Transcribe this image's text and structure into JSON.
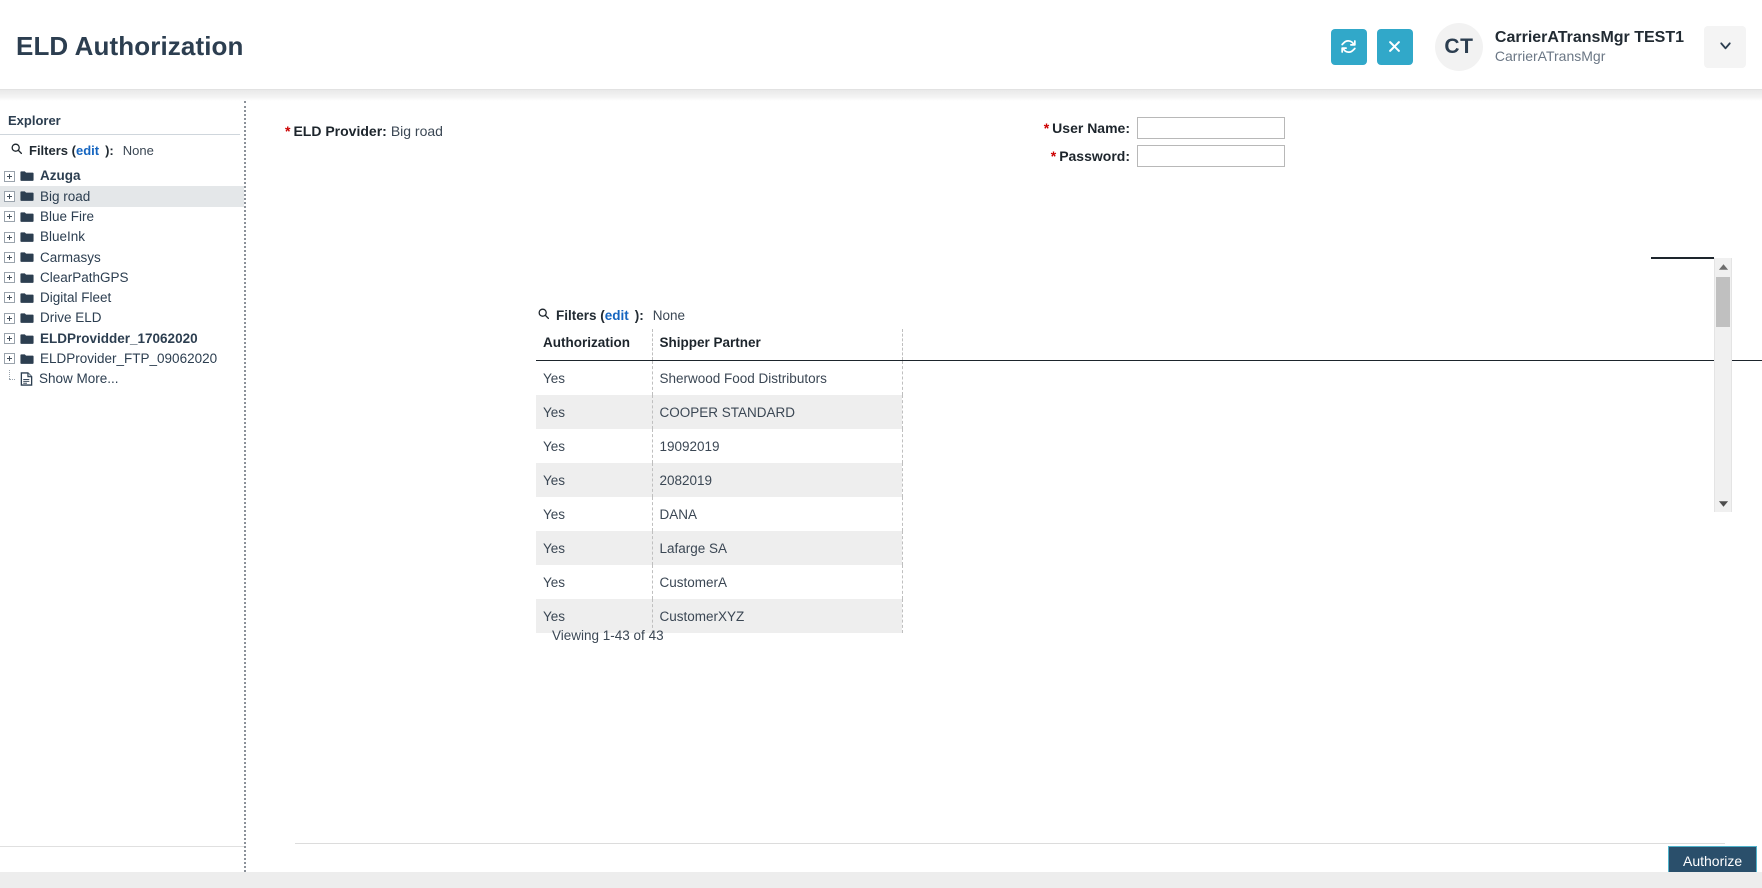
{
  "header": {
    "title": "ELD Authorization",
    "refresh_icon": "refresh-icon",
    "close_icon": "close-icon",
    "avatar_initials": "CT",
    "user_name": "CarrierATransMgr TEST1",
    "user_role": "CarrierATransMgr",
    "caret_icon": "chevron-down-icon"
  },
  "sidebar": {
    "title": "Explorer",
    "filters": {
      "icon": "search-icon",
      "label": "Filters (",
      "edit_label": "edit",
      "label_suffix": "):",
      "value": "None"
    },
    "items": [
      {
        "label": "Azuga",
        "bold": true,
        "selected": false,
        "type": "folder"
      },
      {
        "label": "Big road",
        "bold": false,
        "selected": true,
        "type": "folder"
      },
      {
        "label": "Blue Fire",
        "bold": false,
        "selected": false,
        "type": "folder"
      },
      {
        "label": "BlueInk",
        "bold": false,
        "selected": false,
        "type": "folder"
      },
      {
        "label": "Carmasys",
        "bold": false,
        "selected": false,
        "type": "folder"
      },
      {
        "label": "ClearPathGPS",
        "bold": false,
        "selected": false,
        "type": "folder"
      },
      {
        "label": "Digital Fleet",
        "bold": false,
        "selected": false,
        "type": "folder"
      },
      {
        "label": "Drive ELD",
        "bold": false,
        "selected": false,
        "type": "folder"
      },
      {
        "label": "ELDProvidder_17062020",
        "bold": true,
        "selected": false,
        "type": "folder"
      },
      {
        "label": "ELDProvider_FTP_09062020",
        "bold": false,
        "selected": false,
        "type": "folder"
      },
      {
        "label": "Show More...",
        "bold": false,
        "selected": false,
        "type": "document"
      }
    ]
  },
  "main": {
    "eld_provider": {
      "star": "*",
      "label": "ELD Provider:",
      "value": "Big road"
    },
    "credentials": [
      {
        "star": "*",
        "label": "User Name:",
        "value": "",
        "placeholder": ""
      },
      {
        "star": "*",
        "label": "Password:",
        "value": "",
        "placeholder": ""
      }
    ],
    "grid_filters": {
      "icon": "search-icon",
      "label": "Filters (",
      "edit_label": "edit",
      "label_suffix": "):",
      "value": "None"
    },
    "table": {
      "columns": [
        "Authorization",
        "Shipper Partner",
        ""
      ],
      "rows": [
        [
          "Yes",
          "Sherwood Food Distributors",
          ""
        ],
        [
          "Yes",
          "COOPER STANDARD",
          ""
        ],
        [
          "Yes",
          "19092019",
          ""
        ],
        [
          "Yes",
          "2082019",
          ""
        ],
        [
          "Yes",
          "DANA",
          ""
        ],
        [
          "Yes",
          "Lafarge SA",
          ""
        ],
        [
          "Yes",
          "CustomerA",
          ""
        ],
        [
          "Yes",
          "CustomerXYZ",
          ""
        ]
      ]
    },
    "viewing_text": "Viewing 1-43 of 43",
    "authorize_label": "Authorize",
    "scrollbar": {
      "up_icon": "triangle-up-icon",
      "down_icon": "triangle-down-icon"
    }
  },
  "colors": {
    "accent_teal": "#31a8c9",
    "title_navy": "#2c3e50",
    "button_navy": "#2a4f6b",
    "link_blue": "#1565c0",
    "required_red": "#cc0000"
  }
}
